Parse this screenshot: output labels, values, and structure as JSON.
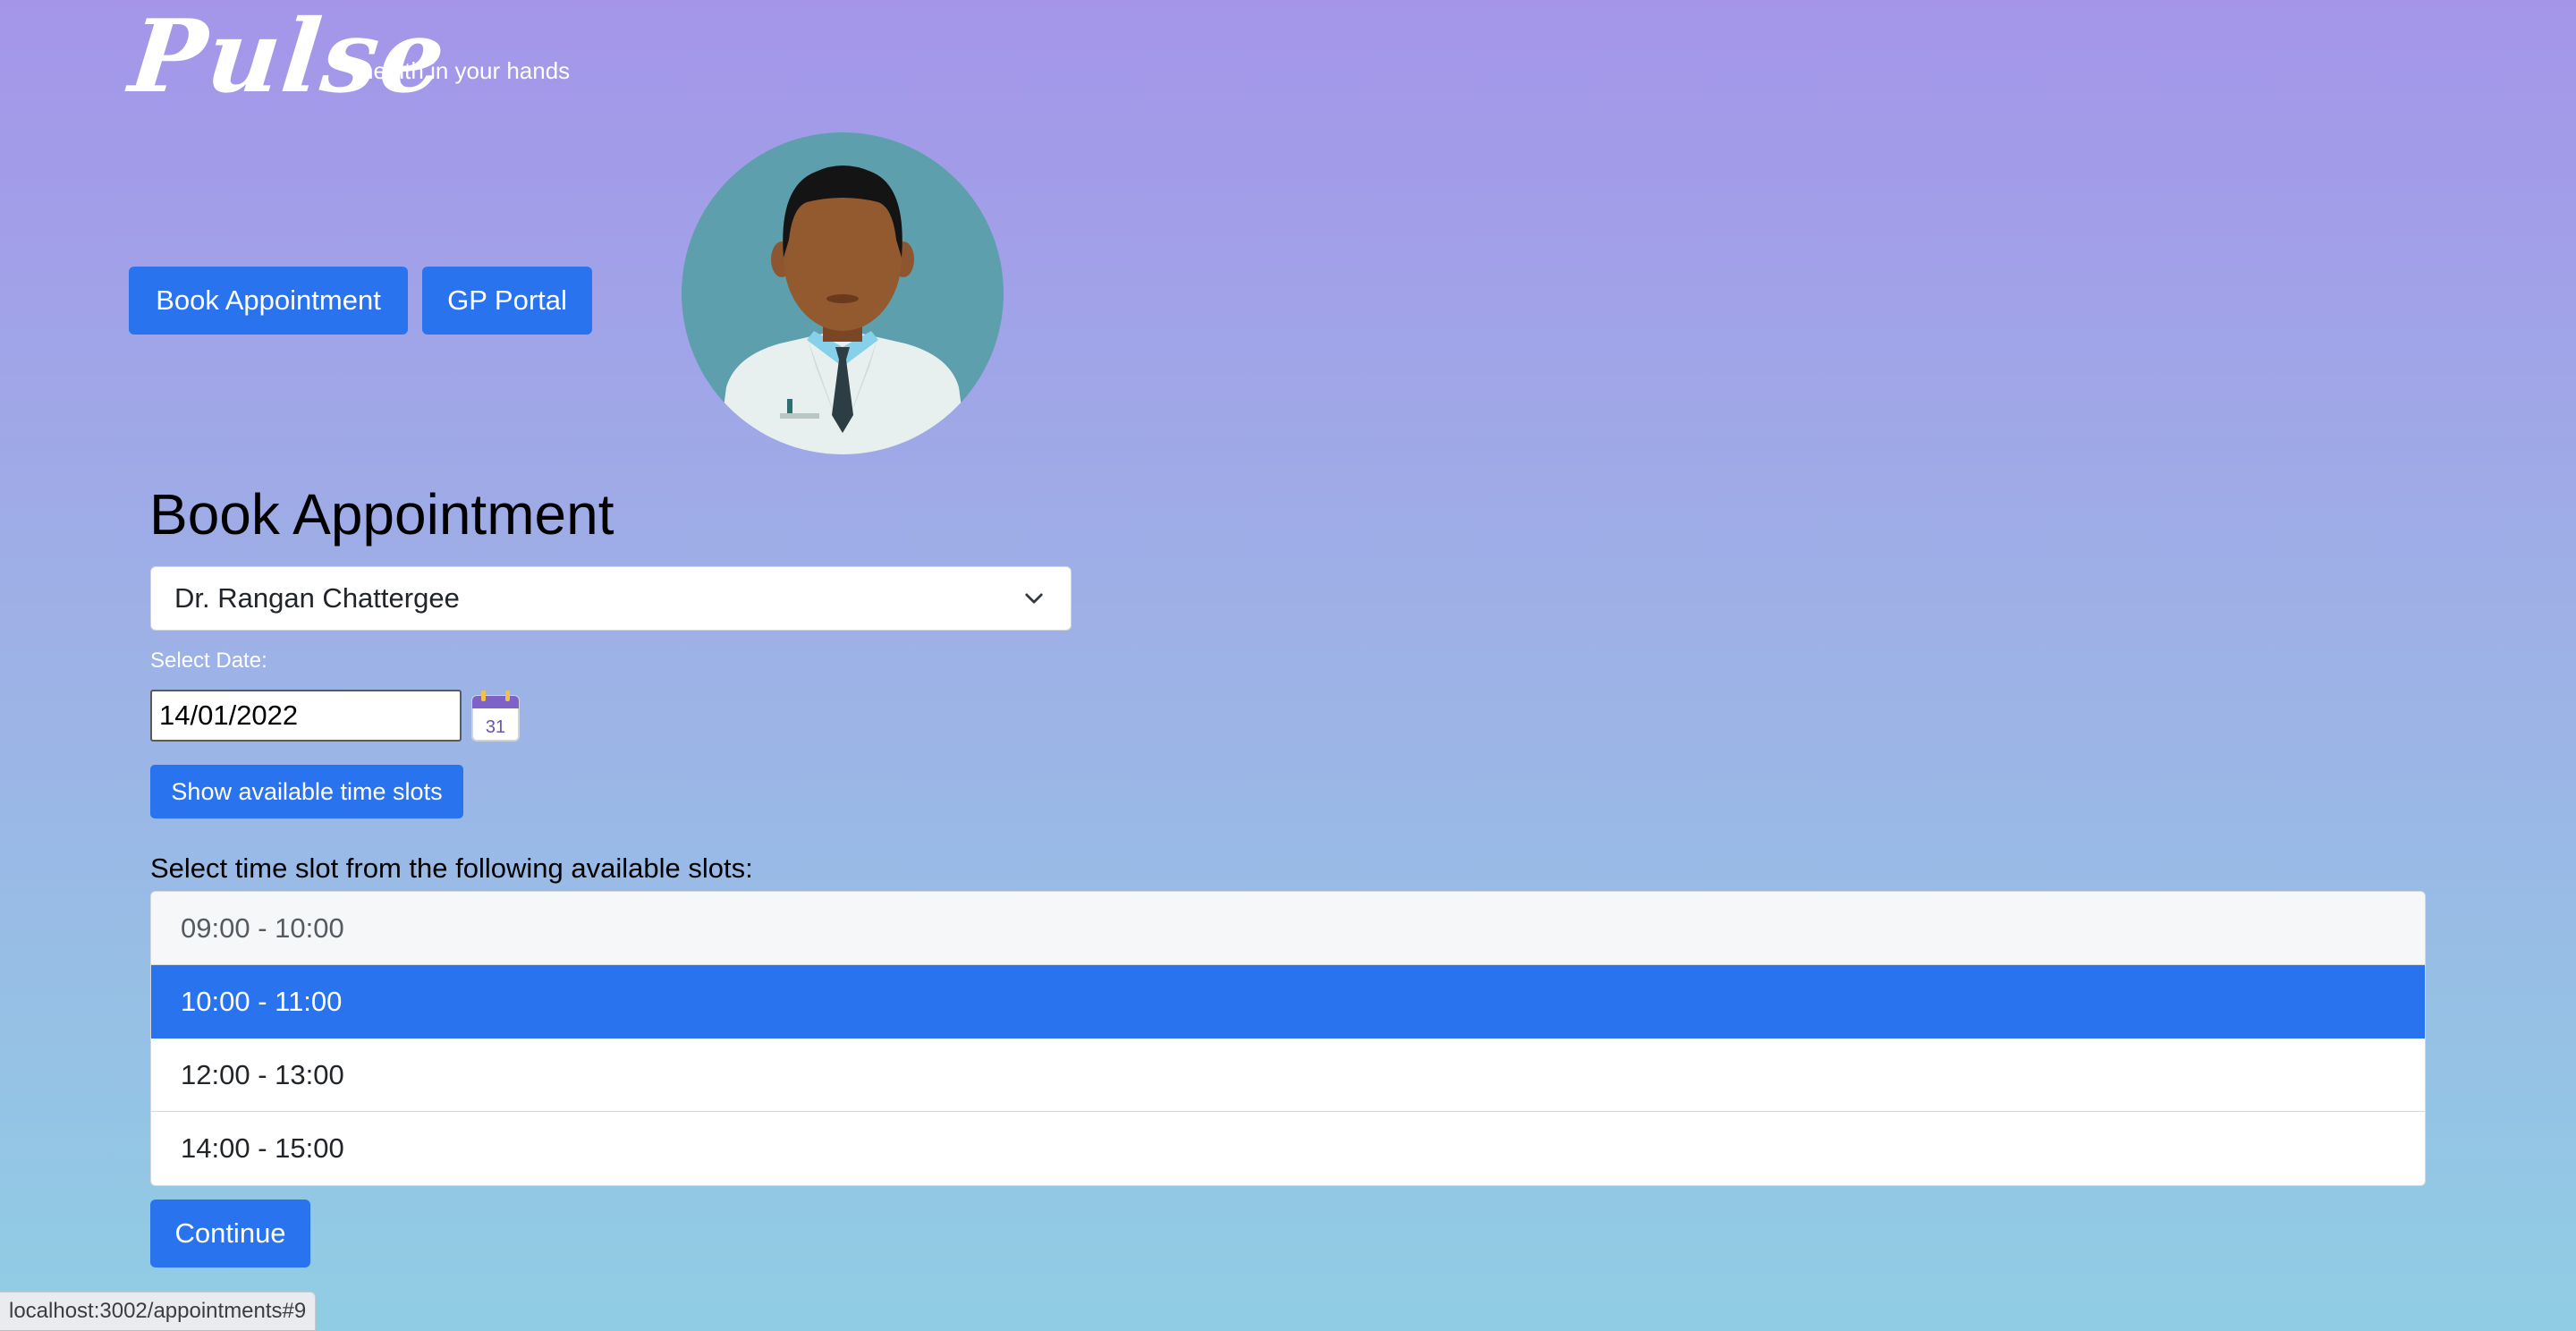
{
  "brand": {
    "logo": "Pulse",
    "tagline": "health in your hands"
  },
  "nav": {
    "book_label": "Book Appointment",
    "gp_label": "GP Portal"
  },
  "page": {
    "title": "Book Appointment"
  },
  "form": {
    "doctor_selected": "Dr. Rangan Chattergee",
    "date_label": "Select Date:",
    "date_value": "14/01/2022",
    "calendar_day": "31",
    "show_slots_label": "Show available time slots",
    "slots_label": "Select time slot from the following available slots:",
    "slots": [
      {
        "label": "09:00 - 10:00",
        "state": "disabled"
      },
      {
        "label": "10:00 - 11:00",
        "state": "active"
      },
      {
        "label": "12:00 - 13:00",
        "state": "available"
      },
      {
        "label": "14:00 - 15:00",
        "state": "available"
      }
    ],
    "continue_label": "Continue"
  },
  "status_bar": {
    "url": "localhost:3002/appointments#9"
  },
  "colors": {
    "primary": "#2a73ee",
    "gradient_top": "#a495e9",
    "gradient_bottom": "#90cde4"
  }
}
